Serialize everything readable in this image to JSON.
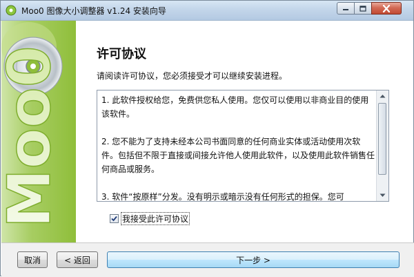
{
  "window": {
    "title": "Moo0 图像大小调整器 v1.24 安装向导",
    "controls": {
      "minimize": "minimize-icon",
      "maximize": "maximize-icon",
      "close": "close-icon"
    }
  },
  "banner": {
    "logo_text": "Moo0",
    "colors": {
      "green_light": "#cfe5a8",
      "green_dark": "#8fbe3a",
      "cd_silver": "#d8dde2"
    }
  },
  "page": {
    "title": "许可协议",
    "description": "请阅读许可协议，您必须接受才可以继续安装进程。"
  },
  "license": {
    "paragraphs": [
      "1. 此软件授权给您，免费供您私人使用。您仅可以使用以非商业目的使用该软件。",
      "2. 您不能为了支持未经本公司书面同意的任何商业实体或活动使用次软件。包括但不限于直接或间接允许他人使用此软件，以及使用此软件销售任何商品或服务。",
      "3. 软件“按原样”分发。没有明示或暗示没有任何形式的担保。您可"
    ]
  },
  "accept": {
    "label": "我接受此许可协议",
    "checked": true
  },
  "buttons": {
    "cancel": "取消",
    "back": "< 返回",
    "next": "下一步 >"
  }
}
